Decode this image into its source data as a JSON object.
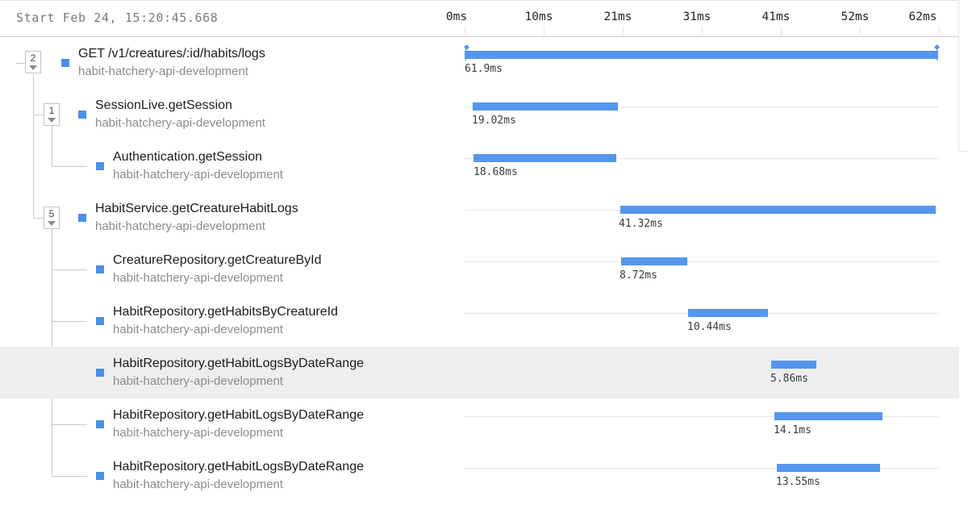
{
  "header": {
    "start_label": "Start Feb 24, 15:20:45.668",
    "ticks": [
      "0ms",
      "10ms",
      "21ms",
      "31ms",
      "41ms",
      "52ms",
      "62ms"
    ]
  },
  "colors": {
    "bar": "#5596ee",
    "square": "#4a90e8",
    "highlight_row": "#eeeeee"
  },
  "spans": [
    {
      "name": "GET /v1/creatures/:id/habits/logs",
      "service": "habit-hatchery-api-development",
      "duration": "61.9ms",
      "child_count": "2",
      "depth": 0,
      "start_ms": 0,
      "duration_ms": 61.9
    },
    {
      "name": "SessionLive.getSession",
      "service": "habit-hatchery-api-development",
      "duration": "19.02ms",
      "child_count": "1",
      "depth": 1,
      "start_ms": 1.0,
      "duration_ms": 19.02
    },
    {
      "name": "Authentication.getSession",
      "service": "habit-hatchery-api-development",
      "duration": "18.68ms",
      "child_count": "",
      "depth": 2,
      "start_ms": 1.2,
      "duration_ms": 18.68
    },
    {
      "name": "HabitService.getCreatureHabitLogs",
      "service": "habit-hatchery-api-development",
      "duration": "41.32ms",
      "child_count": "5",
      "depth": 1,
      "start_ms": 20.3,
      "duration_ms": 41.32
    },
    {
      "name": "CreatureRepository.getCreatureById",
      "service": "habit-hatchery-api-development",
      "duration": "8.72ms",
      "child_count": "",
      "depth": 2,
      "start_ms": 20.4,
      "duration_ms": 8.72
    },
    {
      "name": "HabitRepository.getHabitsByCreatureId",
      "service": "habit-hatchery-api-development",
      "duration": "10.44ms",
      "child_count": "",
      "depth": 2,
      "start_ms": 29.2,
      "duration_ms": 10.44
    },
    {
      "name": "HabitRepository.getHabitLogsByDateRange",
      "service": "habit-hatchery-api-development",
      "duration": "5.86ms",
      "child_count": "",
      "depth": 2,
      "start_ms": 40.1,
      "duration_ms": 5.86,
      "highlighted": true
    },
    {
      "name": "HabitRepository.getHabitLogsByDateRange",
      "service": "habit-hatchery-api-development",
      "duration": "14.1ms",
      "child_count": "",
      "depth": 2,
      "start_ms": 40.5,
      "duration_ms": 14.1
    },
    {
      "name": "HabitRepository.getHabitLogsByDateRange",
      "service": "habit-hatchery-api-development",
      "duration": "13.55ms",
      "child_count": "",
      "depth": 2,
      "start_ms": 40.8,
      "duration_ms": 13.55
    }
  ]
}
